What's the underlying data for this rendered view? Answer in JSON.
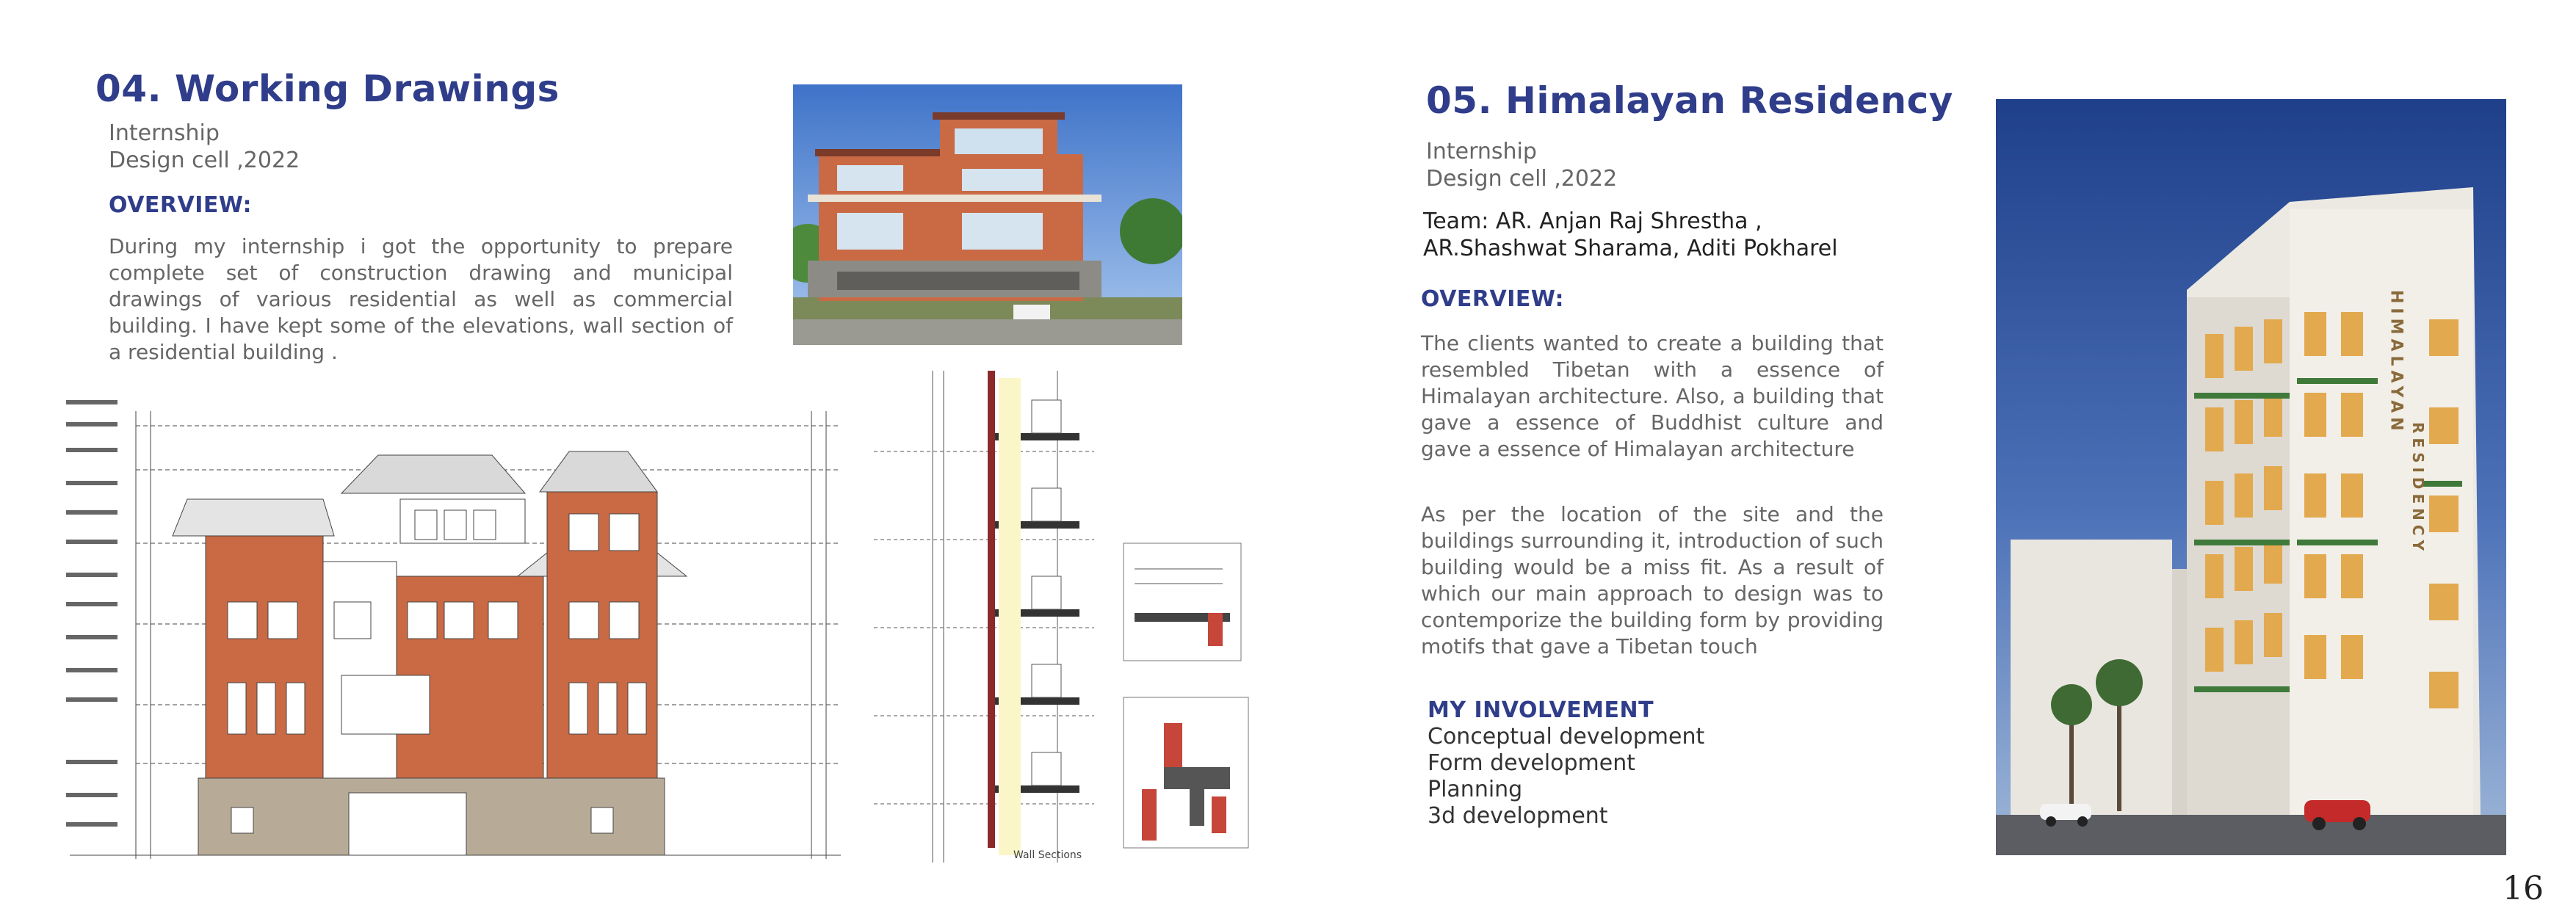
{
  "left": {
    "title": "04. Working Drawings",
    "sub1": "Internship",
    "sub2": "Design cell ,2022",
    "overview_label": "OVERVIEW:",
    "overview_text": "During my internship i got the opportunity to prepare complete set of construction drawing and municipal drawings of various residential as well as commercial building. I have kept some of the elevations, wall section of a residential building .",
    "wall_sections_caption": "Wall Sections"
  },
  "right": {
    "title": "05. Himalayan Residency",
    "sub1": "Internship",
    "sub2": "Design cell ,2022",
    "team_line1": "Team: AR. Anjan Raj Shrestha ,",
    "team_line2": "AR.Shashwat Sharama, Aditi Pokharel",
    "overview_label": "OVERVIEW:",
    "para1": "The clients wanted to create a building that resembled Tibetan with a essence of Himalayan architecture. Also, a building that gave a essence of Buddhist culture and gave a essence of Himalayan architecture",
    "para2": "As per the location of the site and the buildings surrounding it, introduction of such building would be a miss fit. As a result of which our main approach to design was to contemporize the building form by providing motifs that gave a Tibetan touch",
    "involvement_label": "MY INVOLVEMENT",
    "involvement_items": [
      "Conceptual development",
      "Form development",
      "Planning",
      "3d development"
    ],
    "building_sign_1": "HIMALAYAN",
    "building_sign_2": "RESIDENCY"
  },
  "page_number": "16",
  "colors": {
    "accent": "#2f3d8a",
    "brick": "#c96a45",
    "sky": "#4a78c8"
  }
}
